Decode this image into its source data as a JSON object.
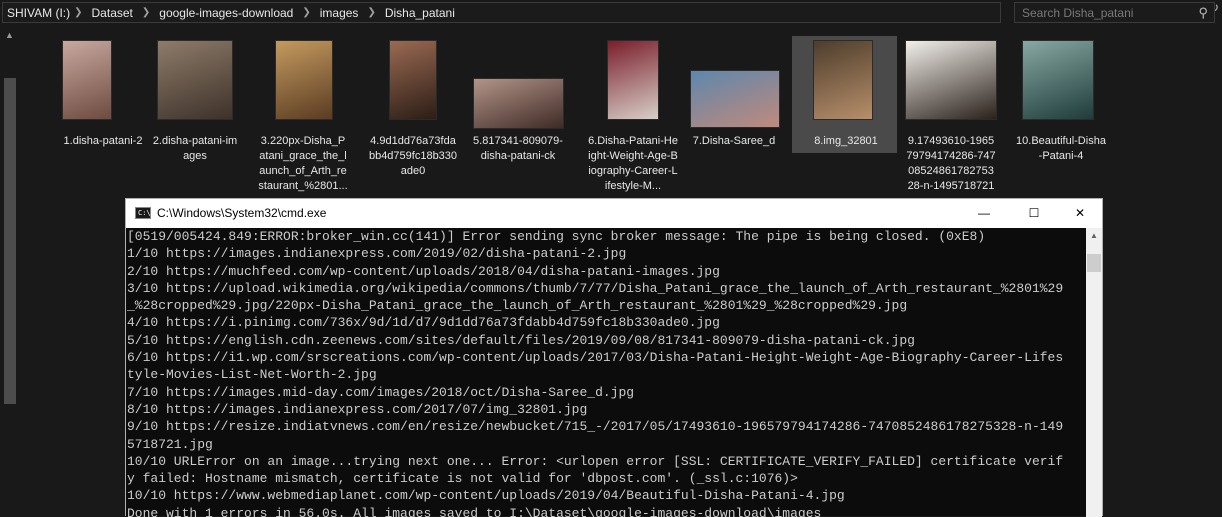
{
  "explorer": {
    "breadcrumb": [
      "SHIVAM (I:)",
      "Dataset",
      "google-images-download",
      "images",
      "Disha_patani"
    ],
    "search_placeholder": "Search Disha_patani",
    "selected_index": 7,
    "files": [
      {
        "label": "1.disha-patani-2",
        "colors": [
          "#c9a8a0",
          "#6d4b3f"
        ]
      },
      {
        "label": "2.disha-patani-images",
        "colors": [
          "#8e7c6a",
          "#3d3129"
        ]
      },
      {
        "label": "3.220px-Disha_Patani_grace_the_launch_of_Arth_restaurant_%2801...",
        "colors": [
          "#c49a5e",
          "#5a3c22"
        ]
      },
      {
        "label": "4.9d1dd76a73fdabb4d759fc18b330ade0",
        "colors": [
          "#9a6a52",
          "#2c1d16"
        ]
      },
      {
        "label": "5.817341-809079-disha-patani-ck",
        "colors": [
          "#b39489",
          "#3e2b25"
        ]
      },
      {
        "label": "6.Disha-Patani-Height-Weight-Age-Biography-Career-Lifestyle-M...",
        "colors": [
          "#7a1e2a",
          "#d8cfc8"
        ]
      },
      {
        "label": "7.Disha-Saree_d",
        "colors": [
          "#5d87ad",
          "#c08a7c"
        ]
      },
      {
        "label": "8.img_32801",
        "colors": [
          "#4d3d2c",
          "#b78f6b"
        ]
      },
      {
        "label": "9.17493610-196579794174286-7470852486178275328-n-1495718721",
        "colors": [
          "#f2efea",
          "#2b211b"
        ]
      },
      {
        "label": "10.Beautiful-Disha-Patani-4",
        "colors": [
          "#88a8a3",
          "#1f3c3a"
        ]
      }
    ]
  },
  "cmd": {
    "title": "C:\\Windows\\System32\\cmd.exe",
    "minimize": "—",
    "maximize": "☐",
    "close": "✕",
    "lines": [
      "[0519/005424.849:ERROR:broker_win.cc(141)] Error sending sync broker message: The pipe is being closed. (0xE8)",
      "1/10 https://images.indianexpress.com/2019/02/disha-patani-2.jpg",
      "2/10 https://muchfeed.com/wp-content/uploads/2018/04/disha-patani-images.jpg",
      "3/10 https://upload.wikimedia.org/wikipedia/commons/thumb/7/77/Disha_Patani_grace_the_launch_of_Arth_restaurant_%2801%29",
      "_%28cropped%29.jpg/220px-Disha_Patani_grace_the_launch_of_Arth_restaurant_%2801%29_%28cropped%29.jpg",
      "4/10 https://i.pinimg.com/736x/9d/1d/d7/9d1dd76a73fdabb4d759fc18b330ade0.jpg",
      "5/10 https://english.cdn.zeenews.com/sites/default/files/2019/09/08/817341-809079-disha-patani-ck.jpg",
      "6/10 https://i1.wp.com/srscreations.com/wp-content/uploads/2017/03/Disha-Patani-Height-Weight-Age-Biography-Career-Lifes",
      "tyle-Movies-List-Net-Worth-2.jpg",
      "7/10 https://images.mid-day.com/images/2018/oct/Disha-Saree_d.jpg",
      "8/10 https://images.indianexpress.com/2017/07/img_32801.jpg",
      "9/10 https://resize.indiatvnews.com/en/resize/newbucket/715_-/2017/05/17493610-196579794174286-7470852486178275328-n-149",
      "5718721.jpg",
      "10/10 URLError on an image...trying next one... Error: <urlopen error [SSL: CERTIFICATE_VERIFY_FAILED] certificate verif",
      "y failed: Hostname mismatch, certificate is not valid for 'dbpost.com'. (_ssl.c:1076)>",
      "10/10 https://www.webmediaplanet.com/wp-content/uploads/2019/04/Beautiful-Disha-Patani-4.jpg",
      "Done with 1 errors in 56.0s. All images saved to I:\\Dataset\\google-images-download\\images"
    ]
  }
}
